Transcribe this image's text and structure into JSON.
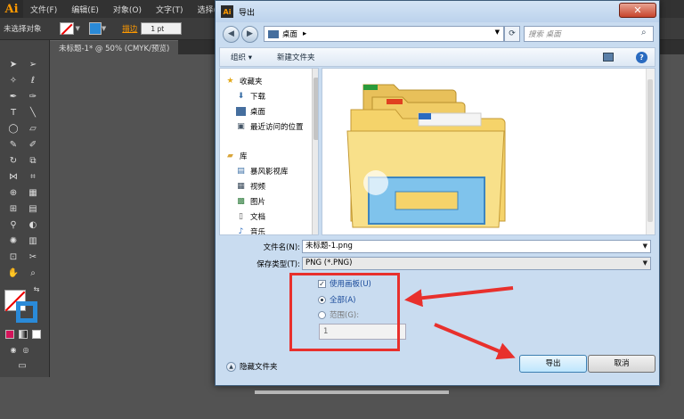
{
  "app": {
    "logo": "Ai",
    "menus": [
      "文件(F)",
      "编辑(E)",
      "对象(O)",
      "文字(T)",
      "选择(S)"
    ]
  },
  "control_bar": {
    "selection_label": "未选择对象",
    "stroke_label": "描边",
    "stroke_value": "1 pt"
  },
  "document_tab": "未标题-1* @ 50% (CMYK/预览)",
  "dialog": {
    "title": "导出",
    "close_label": "✕",
    "address": {
      "location": "桌面",
      "separator": "▸"
    },
    "search_placeholder": "搜索 桌面",
    "toolbar": {
      "organize": "组织 ▾",
      "new_folder": "新建文件夹"
    },
    "nav": {
      "favorites_header": "收藏夹",
      "favorites": [
        "下载",
        "桌面",
        "最近访问的位置"
      ],
      "library_header": "库",
      "libraries": [
        "暴风影视库",
        "视频",
        "图片",
        "文档",
        "音乐"
      ]
    },
    "filename_label": "文件名(N):",
    "filename_value": "未标题-1.png",
    "filetype_label": "保存类型(T):",
    "filetype_value": "PNG (*.PNG)",
    "options": {
      "use_artboards": "使用画板(U)",
      "all": "全部(A)",
      "range": "范围(G):",
      "range_value": "1"
    },
    "hide_folders": "隐藏文件夹",
    "export_button": "导出",
    "cancel_button": "取消"
  },
  "colors": {
    "highlight_box": "#e8302c",
    "folder": "#f5d36a",
    "accent_blue": "#2a8ad8"
  }
}
